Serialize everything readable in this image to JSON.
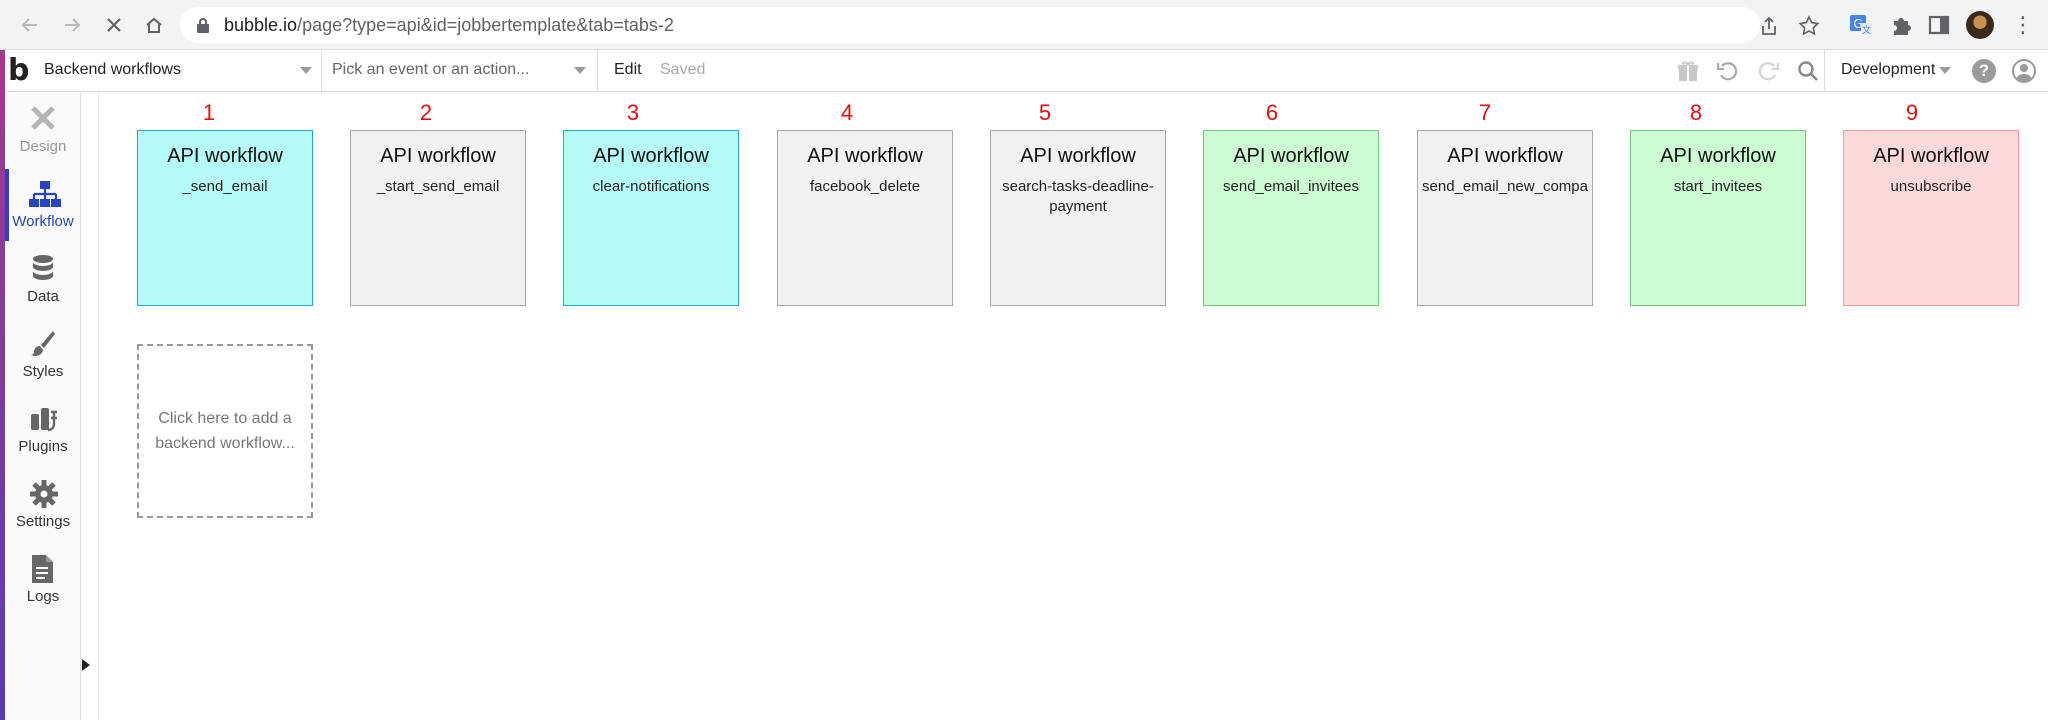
{
  "browser": {
    "url_host": "bubble.io",
    "url_path": "/page?type=api&id=jobbertemplate&tab=tabs-2"
  },
  "toolbar": {
    "page_selector": "Backend workflows",
    "event_placeholder": "Pick an event or an action...",
    "edit_label": "Edit",
    "saved_label": "Saved",
    "environment": "Development"
  },
  "sidebar": {
    "items": [
      {
        "label": "Design",
        "icon": "design-icon",
        "state": "muted"
      },
      {
        "label": "Workflow",
        "icon": "workflow-icon",
        "state": "active"
      },
      {
        "label": "Data",
        "icon": "database-icon",
        "state": "normal"
      },
      {
        "label": "Styles",
        "icon": "brush-icon",
        "state": "normal"
      },
      {
        "label": "Plugins",
        "icon": "plug-icon",
        "state": "normal"
      },
      {
        "label": "Settings",
        "icon": "gear-icon",
        "state": "normal"
      },
      {
        "label": "Logs",
        "icon": "document-icon",
        "state": "normal"
      }
    ]
  },
  "workflows": [
    {
      "number": "1",
      "title": "API workflow",
      "name": "_send_email",
      "color": "cyan"
    },
    {
      "number": "2",
      "title": "API workflow",
      "name": "_start_send_email",
      "color": "gray"
    },
    {
      "number": "3",
      "title": "API workflow",
      "name": "clear-notifications",
      "color": "cyan"
    },
    {
      "number": "4",
      "title": "API workflow",
      "name": "facebook_delete",
      "color": "gray"
    },
    {
      "number": "5",
      "title": "API workflow",
      "name": "search-tasks-deadline-payment",
      "color": "gray"
    },
    {
      "number": "6",
      "title": "API workflow",
      "name": "send_email_invitees",
      "color": "green"
    },
    {
      "number": "7",
      "title": "API workflow",
      "name": "send_email_new_compa",
      "color": "gray"
    },
    {
      "number": "8",
      "title": "API workflow",
      "name": "start_invitees",
      "color": "green"
    },
    {
      "number": "9",
      "title": "API workflow",
      "name": "unsubscribe",
      "color": "pink"
    }
  ],
  "add_workflow_text": "Click here to add a backend workflow...",
  "colors": {
    "cyan": "#b5fcf8",
    "gray": "#f1f1f1",
    "green": "#ccfcd2",
    "pink": "#fdd9d9",
    "accent": "#2844c4",
    "annotation": "#e01010"
  }
}
